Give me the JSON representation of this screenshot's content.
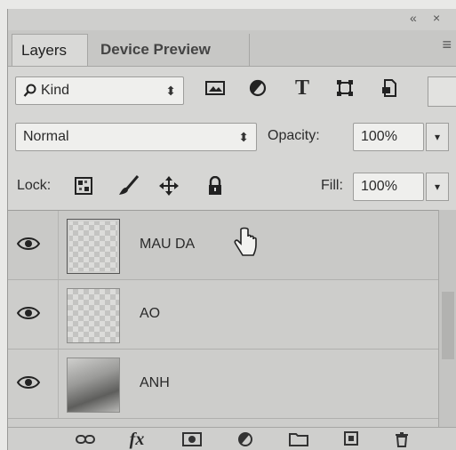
{
  "tabs": [
    {
      "label": "Layers"
    },
    {
      "label": "Device Preview"
    }
  ],
  "filter": {
    "label": "Kind",
    "arrows": "⬍"
  },
  "filter_icons": [
    "image-filter-icon",
    "adjustment-filter-icon",
    "type-filter-icon",
    "shape-filter-icon",
    "smart-object-filter-icon"
  ],
  "type_glyph": "T",
  "blend": {
    "mode": "Normal",
    "arrows": "⬍",
    "opacity_label": "Opacity:",
    "opacity_value": "100%"
  },
  "lock": {
    "label": "Lock:",
    "fill_label": "Fill:",
    "fill_value": "100%"
  },
  "dropdown_glyph": "▾",
  "layers": [
    {
      "name": "MAU DA",
      "visible": true
    },
    {
      "name": "AO",
      "visible": true
    },
    {
      "name": "ANH",
      "visible": true
    }
  ],
  "bottom_icons": [
    "link-layers-icon",
    "layer-style-icon",
    "add-mask-icon",
    "adjustment-layer-icon",
    "new-group-icon",
    "new-layer-icon",
    "delete-layer-icon"
  ],
  "fx_label": "fx",
  "window_controls": {
    "collapse": "«",
    "close": "×"
  },
  "panel_menu_glyph": "≡"
}
